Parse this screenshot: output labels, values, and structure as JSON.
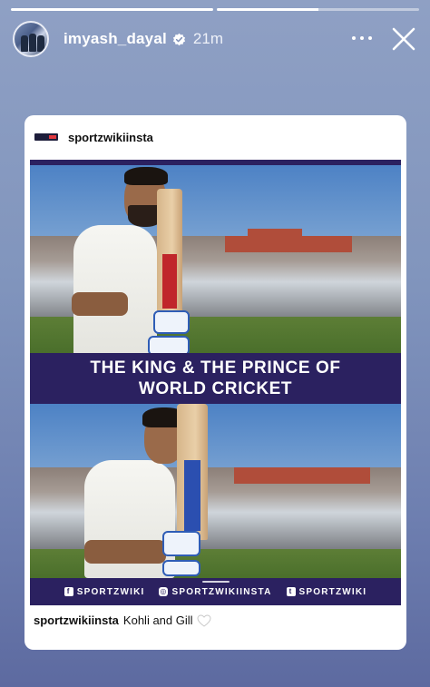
{
  "story": {
    "progress_segments": [
      1,
      0.5
    ],
    "username": "imyash_dayal",
    "time": "21m"
  },
  "post": {
    "account": "sportzwikiinsta",
    "headline_line1": "THE KING & THE PRINCE OF",
    "headline_line2": "WORLD CRICKET",
    "socials": [
      {
        "icon": "facebook-icon",
        "label": "SPORTZWIKI"
      },
      {
        "icon": "instagram-icon",
        "label": "SPORTZWIKIINSTA"
      },
      {
        "icon": "twitter-icon",
        "label": "SPORTZWIKI"
      }
    ],
    "caption_user": "sportzwikiinsta",
    "caption_text": "Kohli and Gill"
  },
  "colors": {
    "banner": "#2b2160",
    "verified": "#3897f0"
  }
}
